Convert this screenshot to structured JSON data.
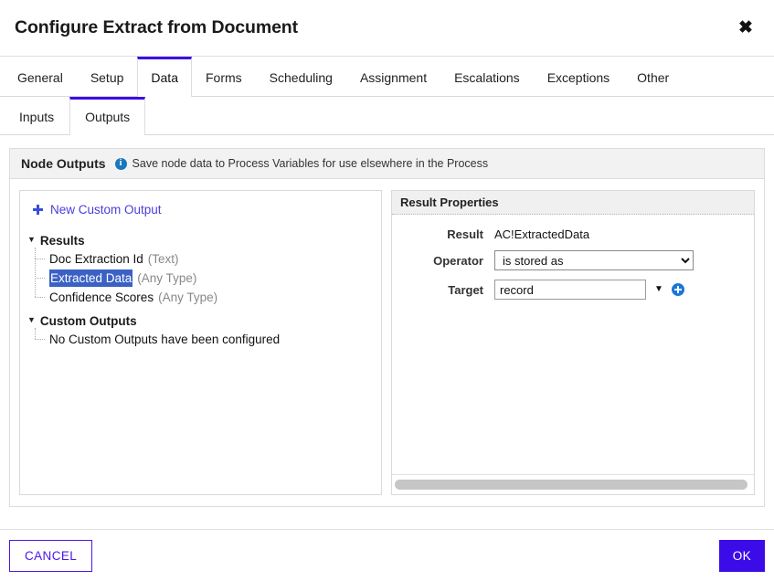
{
  "header": {
    "title": "Configure Extract from Document",
    "close_label": "✖"
  },
  "main_tabs": [
    {
      "label": "General",
      "active": false
    },
    {
      "label": "Setup",
      "active": false
    },
    {
      "label": "Data",
      "active": true
    },
    {
      "label": "Forms",
      "active": false
    },
    {
      "label": "Scheduling",
      "active": false
    },
    {
      "label": "Assignment",
      "active": false
    },
    {
      "label": "Escalations",
      "active": false
    },
    {
      "label": "Exceptions",
      "active": false
    },
    {
      "label": "Other",
      "active": false
    }
  ],
  "sub_tabs": [
    {
      "label": "Inputs",
      "active": false
    },
    {
      "label": "Outputs",
      "active": true
    }
  ],
  "section": {
    "title": "Node Outputs",
    "hint": "Save node data to Process Variables for use elsewhere in the Process",
    "info_icon": "info-icon",
    "info_glyph": "i"
  },
  "tree_panel": {
    "new_output_label": "New Custom Output",
    "new_output_icon": "plus-icon",
    "caret_glyph": "▼",
    "groups": [
      {
        "label": "Results",
        "items": [
          {
            "name": "Doc Extraction Id",
            "type": "(Text)",
            "selected": false
          },
          {
            "name": "Extracted Data",
            "type": "(Any Type)",
            "selected": true
          },
          {
            "name": "Confidence Scores",
            "type": "(Any Type)",
            "selected": false
          }
        ]
      },
      {
        "label": "Custom Outputs",
        "items": [
          {
            "name": "No Custom Outputs have been configured",
            "type": "",
            "selected": false
          }
        ]
      }
    ]
  },
  "props_panel": {
    "title": "Result Properties",
    "result_label": "Result",
    "result_value": "AC!ExtractedData",
    "operator_label": "Operator",
    "operator_value": "is stored as",
    "operator_options": [
      "is stored as"
    ],
    "target_label": "Target",
    "target_value": "record",
    "target_placeholder": "",
    "target_caret_icon": "chevron-down-icon",
    "target_add_icon": "add-circle-icon"
  },
  "footer": {
    "cancel_label": "CANCEL",
    "ok_label": "OK"
  },
  "colors": {
    "accent_purple": "#3c0ce8",
    "selection_blue": "#3b61c4",
    "info_blue": "#1878bb",
    "link_purple": "#4b3ddb"
  }
}
